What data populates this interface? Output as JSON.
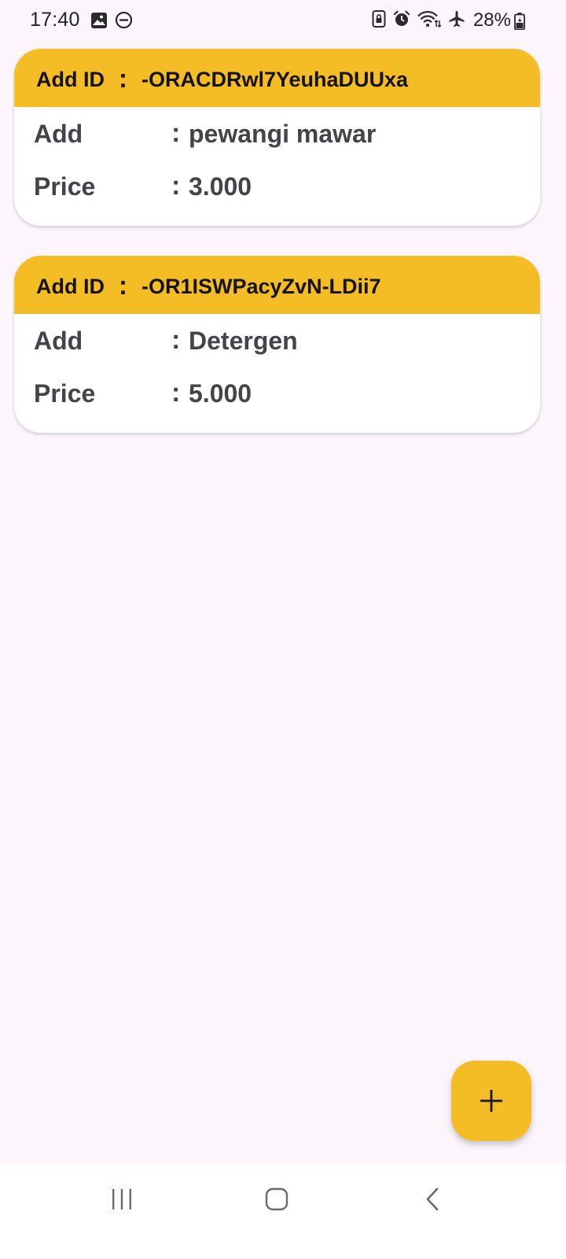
{
  "status_bar": {
    "time": "17:40",
    "battery_percent": "28%",
    "left_icons": [
      "image-icon",
      "do-not-disturb-icon"
    ],
    "right_icons": [
      "lock-icon",
      "alarm-icon",
      "wifi-icon",
      "airplane-icon",
      "battery-icon"
    ]
  },
  "cards": [
    {
      "id_label": "Add ID",
      "colon": ":",
      "id_value": "-ORACDRwl7YeuhaDUUxa",
      "add_label": "Add",
      "add_value": "pewangi mawar",
      "price_label": "Price",
      "price_value": "3.000"
    },
    {
      "id_label": "Add ID",
      "colon": ":",
      "id_value": "-OR1ISWPacyZvN-LDii7",
      "add_label": "Add",
      "add_value": "Detergen",
      "price_label": "Price",
      "price_value": "5.000"
    }
  ],
  "fab": {
    "icon": "plus-icon"
  },
  "nav_bar": {
    "buttons": [
      "recents-icon",
      "home-icon",
      "back-icon"
    ]
  },
  "colors": {
    "accent": "#F4BC25",
    "background": "#FCF6FC",
    "card": "#FFFFFF",
    "text_dark": "#44434B"
  }
}
